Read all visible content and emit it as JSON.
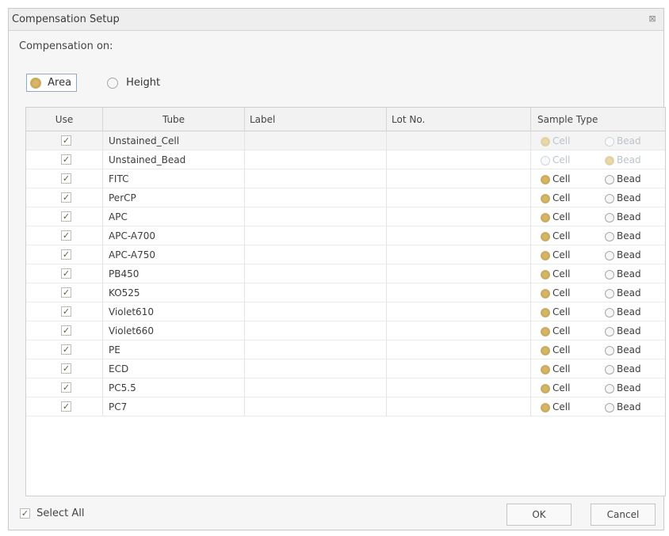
{
  "window": {
    "title": "Compensation Setup",
    "close_glyph": "⊠"
  },
  "compensation": {
    "label": "Compensation on:",
    "options": [
      {
        "label": "Area",
        "selected": true
      },
      {
        "label": "Height",
        "selected": false
      }
    ]
  },
  "table": {
    "columns": [
      "Use",
      "Tube",
      "Label",
      "Lot No.",
      "Sample Type"
    ],
    "rows": [
      {
        "use": true,
        "tube": "Unstained_Cell",
        "label": "",
        "lot": "",
        "sample_type": "Cell",
        "disabled": true
      },
      {
        "use": true,
        "tube": "Unstained_Bead",
        "label": "",
        "lot": "",
        "sample_type": "Bead",
        "disabled": true
      },
      {
        "use": true,
        "tube": "FITC",
        "label": "",
        "lot": "",
        "sample_type": "Cell",
        "disabled": false
      },
      {
        "use": true,
        "tube": "PerCP",
        "label": "",
        "lot": "",
        "sample_type": "Cell",
        "disabled": false
      },
      {
        "use": true,
        "tube": "APC",
        "label": "",
        "lot": "",
        "sample_type": "Cell",
        "disabled": false
      },
      {
        "use": true,
        "tube": "APC-A700",
        "label": "",
        "lot": "",
        "sample_type": "Cell",
        "disabled": false
      },
      {
        "use": true,
        "tube": "APC-A750",
        "label": "",
        "lot": "",
        "sample_type": "Cell",
        "disabled": false
      },
      {
        "use": true,
        "tube": "PB450",
        "label": "",
        "lot": "",
        "sample_type": "Cell",
        "disabled": false
      },
      {
        "use": true,
        "tube": "KO525",
        "label": "",
        "lot": "",
        "sample_type": "Cell",
        "disabled": false
      },
      {
        "use": true,
        "tube": "Violet610",
        "label": "",
        "lot": "",
        "sample_type": "Cell",
        "disabled": false
      },
      {
        "use": true,
        "tube": "Violet660",
        "label": "",
        "lot": "",
        "sample_type": "Cell",
        "disabled": false
      },
      {
        "use": true,
        "tube": "PE",
        "label": "",
        "lot": "",
        "sample_type": "Cell",
        "disabled": false
      },
      {
        "use": true,
        "tube": "ECD",
        "label": "",
        "lot": "",
        "sample_type": "Cell",
        "disabled": false
      },
      {
        "use": true,
        "tube": "PC5.5",
        "label": "",
        "lot": "",
        "sample_type": "Cell",
        "disabled": false
      },
      {
        "use": true,
        "tube": "PC7",
        "label": "",
        "lot": "",
        "sample_type": "Cell",
        "disabled": false
      }
    ],
    "sample_type_options": [
      "Cell",
      "Bead"
    ]
  },
  "footer": {
    "select_all_label": "Select All",
    "select_all_checked": true,
    "ok_label": "OK",
    "cancel_label": "Cancel"
  },
  "colors": {
    "radio_selected": "#d8b667",
    "disabled_text": "#b9c4cc"
  }
}
